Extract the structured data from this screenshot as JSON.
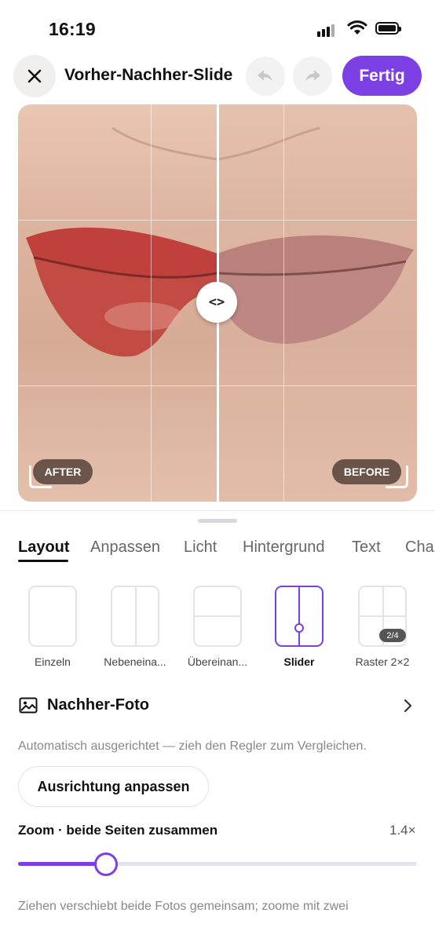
{
  "status_bar": {
    "time": "16:19"
  },
  "header": {
    "title": "Vorher-Nachher-Slide",
    "close_icon": "close-icon",
    "undo_icon": "undo-icon",
    "redo_icon": "redo-icon",
    "done_label": "Fertig"
  },
  "preview": {
    "after_label": "AFTER",
    "before_label": "BEFORE",
    "handle_glyph": "<>",
    "slider_position": 0.5
  },
  "tabs": [
    {
      "label": "Layout",
      "active": true
    },
    {
      "label": "Anpassen"
    },
    {
      "label": "Licht"
    },
    {
      "label": "Hintergrund"
    },
    {
      "label": "Text"
    },
    {
      "label": "Cha"
    }
  ],
  "layouts": [
    {
      "label": "Einzeln"
    },
    {
      "label": "Nebeneina..."
    },
    {
      "label": "Übereinan..."
    },
    {
      "label": "Slider",
      "selected": true
    },
    {
      "label": "Raster 2×2",
      "badge": "2/4"
    }
  ],
  "photo_section": {
    "title": "Nachher-Foto",
    "icon": "image-icon",
    "chevron_icon": "chevron-right-icon"
  },
  "hint": "Automatisch ausgerichtet — zieh den Regler zum Vergleichen.",
  "align_button": "Ausrichtung anpassen",
  "zoom": {
    "label": "Zoom · beide Seiten zusammen",
    "value_text": "1.4×",
    "level": 0.22
  },
  "footer_hint": "Ziehen verschiebt beide Fotos gemeinsam; zoome mit zwei",
  "colors": {
    "accent": "#7b3fe4"
  }
}
